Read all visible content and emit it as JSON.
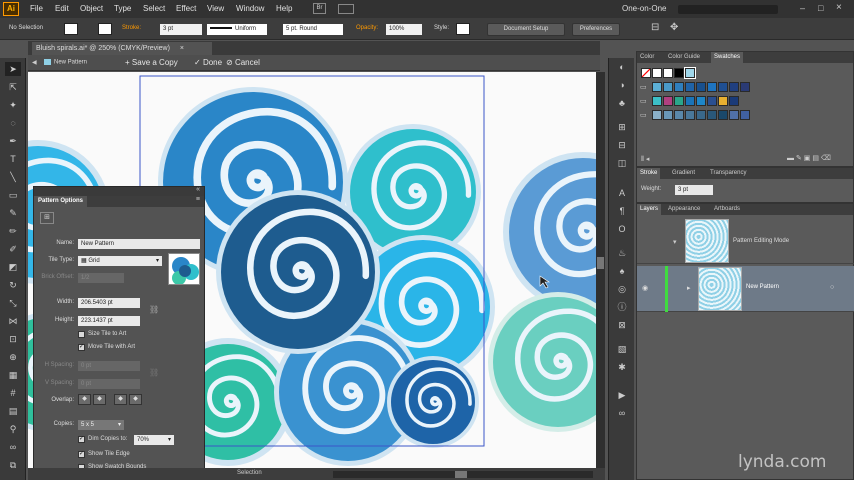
{
  "app": {
    "logo": "Ai",
    "bridge": "Br"
  },
  "menu": [
    "File",
    "Edit",
    "Object",
    "Type",
    "Select",
    "Effect",
    "View",
    "Window",
    "Help"
  ],
  "workspace": "One-on-One",
  "control": {
    "selection": "No Selection",
    "stroke_label": "Stroke:",
    "stroke_value": "3 pt",
    "profile": "Uniform",
    "brush": "5 pt. Round",
    "opacity_label": "Opacity:",
    "opacity_value": "100%",
    "style_label": "Style:",
    "document_setup": "Document Setup",
    "preferences": "Preferences"
  },
  "document_tab": {
    "title": "Bluish spirals.ai* @ 250% (CMYK/Preview)",
    "close": "×"
  },
  "isolation": {
    "back": "◀",
    "name": "New Pattern",
    "save_copy": "Save a Copy",
    "done": "Done",
    "cancel": "Cancel"
  },
  "status": {
    "label": "Selection"
  },
  "swatches_panel": {
    "tabs": [
      "Color",
      "Color Guide",
      "Swatches"
    ]
  },
  "stroke_panel": {
    "tabs": [
      "Stroke",
      "Gradient",
      "Transparency"
    ],
    "weight_label": "Weight:",
    "weight_value": "3 pt"
  },
  "layers_panel": {
    "tabs": [
      "Layers",
      "Appearance",
      "Artboards"
    ],
    "rows": [
      {
        "name": "Pattern Editing Mode"
      },
      {
        "name": "New Pattern"
      }
    ]
  },
  "pattern_options": {
    "title": "Pattern Options",
    "name_label": "Name:",
    "name_value": "New Pattern",
    "tile_type_label": "Tile Type:",
    "tile_type_value": "Grid",
    "brick_offset_label": "Brick Offset:",
    "brick_offset_value": "1/2",
    "width_label": "Width:",
    "width_value": "206.5403 pt",
    "height_label": "Height:",
    "height_value": "223.1437 pt",
    "size_tile_label": "Size Tile to Art",
    "move_tile_label": "Move Tile with Art",
    "h_spacing_label": "H Spacing:",
    "h_spacing_value": "0 pt",
    "v_spacing_label": "V Spacing:",
    "v_spacing_value": "0 pt",
    "overlap_label": "Overlap:",
    "copies_label": "Copies:",
    "copies_value": "5 x 5",
    "dim_label": "Dim Copies to:",
    "dim_value": "70%",
    "show_tile_edge": "Show Tile Edge",
    "show_swatch_bounds": "Show Swatch Bounds"
  },
  "watermark": "lynda.com",
  "colors": {
    "accent": "#ff9a00",
    "spiral_dark": "#1f5f95",
    "spiral_blue": "#2a8fd0",
    "spiral_teal": "#2fbfcc",
    "spiral_green": "#3cc8a8",
    "spiral_light": "#6aa6d8"
  }
}
